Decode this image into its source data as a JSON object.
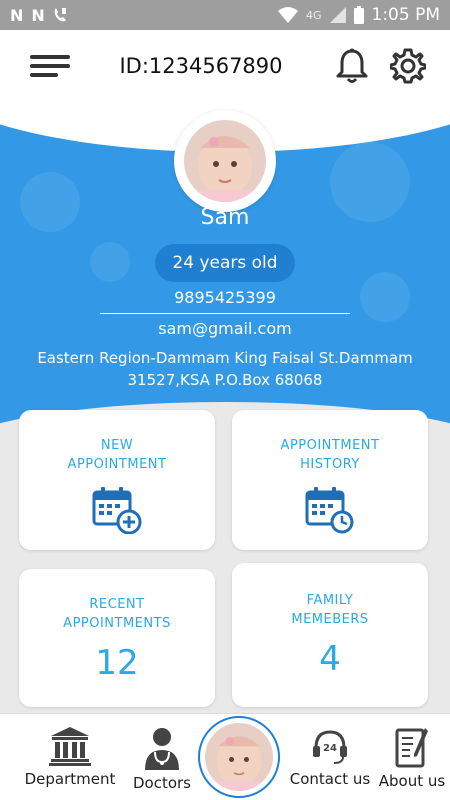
{
  "status_bar": {
    "time": "1:05 PM",
    "network": "4G"
  },
  "header": {
    "id_text": "ID:1234567890",
    "menu_icon": "menu-icon",
    "bell_icon": "bell-icon",
    "settings_icon": "gear-icon"
  },
  "profile": {
    "name": "Sam",
    "age": "24 years old",
    "phone": "9895425399",
    "email": "sam@gmail.com",
    "address_line1": "Eastern Region-Dammam King Faisal St.Dammam",
    "address_line2": "31527,KSA P.O.Box 68068"
  },
  "cards": {
    "new_appointment": {
      "line1": "NEW",
      "line2": "APPOINTMENT",
      "icon": "calendar-add-icon"
    },
    "appointment_history": {
      "line1": "APPOINTMENT",
      "line2": "HISTORY",
      "icon": "calendar-clock-icon"
    },
    "recent_appointments": {
      "line1": "RECENT",
      "line2": "APPOINTMENTS",
      "count": "12"
    },
    "family_members": {
      "line1": "FAMILY",
      "line2": "MEMEBERS",
      "count": "4"
    }
  },
  "bottom_nav": {
    "department": "Department",
    "doctors": "Doctors",
    "contact": "Contact us",
    "about": "About us"
  },
  "colors": {
    "primary_blue": "#3399e6",
    "badge_blue": "#1f7fd0",
    "card_text": "#29a9e6"
  }
}
